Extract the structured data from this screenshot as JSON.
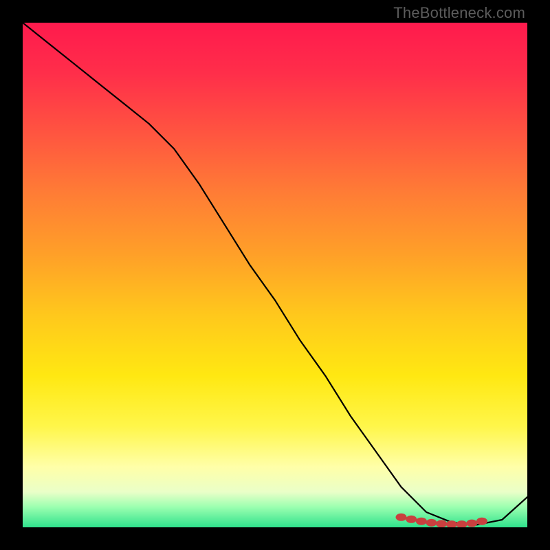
{
  "watermark": "TheBottleneck.com",
  "chart_data": {
    "type": "line",
    "title": "",
    "xlabel": "",
    "ylabel": "",
    "xlim": [
      0,
      100
    ],
    "ylim": [
      0,
      100
    ],
    "x": [
      0,
      5,
      10,
      15,
      20,
      25,
      30,
      35,
      40,
      45,
      50,
      55,
      60,
      65,
      70,
      75,
      80,
      85,
      90,
      95,
      100
    ],
    "values": [
      100,
      96,
      92,
      88,
      84,
      80,
      75,
      68,
      60,
      52,
      45,
      37,
      30,
      22,
      15,
      8,
      3,
      1,
      0.5,
      1.5,
      6
    ],
    "markers": {
      "color": "#c9403f",
      "x": [
        75,
        77,
        79,
        81,
        83,
        85,
        87,
        89,
        91
      ],
      "values": [
        2.0,
        1.6,
        1.2,
        0.9,
        0.7,
        0.6,
        0.6,
        0.8,
        1.2
      ]
    },
    "background": "red-yellow-green vertical gradient"
  }
}
